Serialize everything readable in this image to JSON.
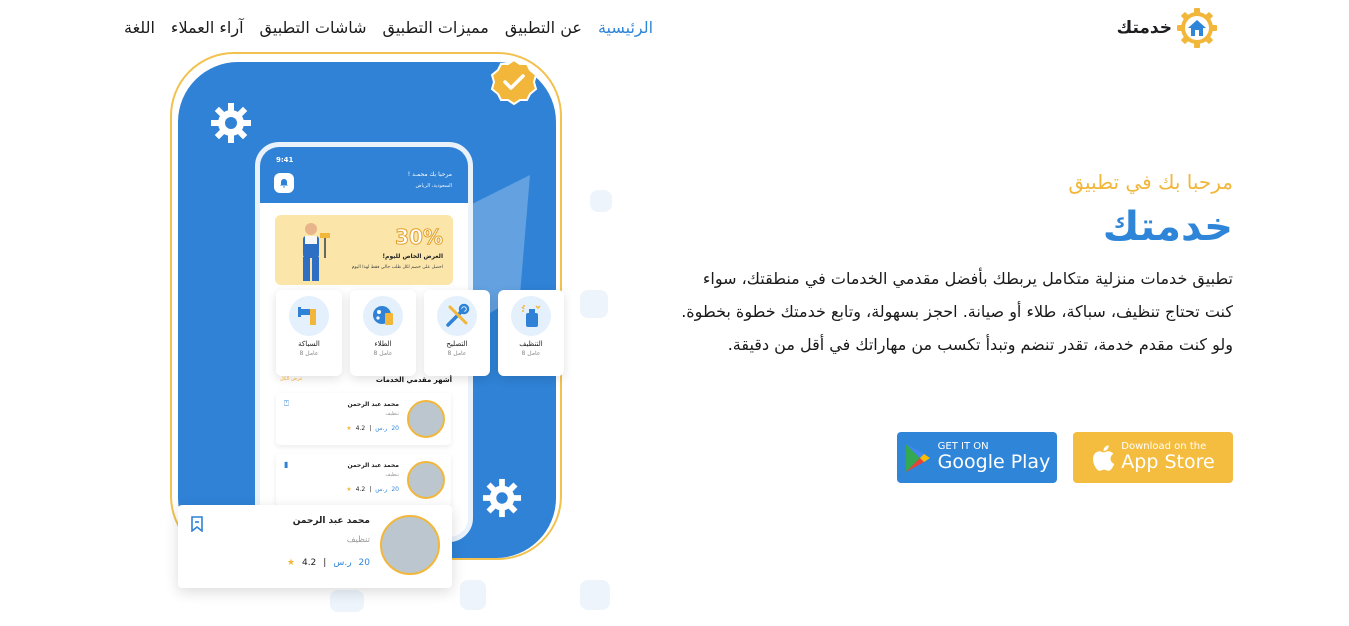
{
  "brand": {
    "name": "خدمتك",
    "logo_icon": "house-gear-icon"
  },
  "nav": {
    "items": [
      {
        "label": "الرئيسية",
        "active": true
      },
      {
        "label": "عن التطبيق",
        "active": false
      },
      {
        "label": "مميزات التطبيق",
        "active": false
      },
      {
        "label": "شاشات التطبيق",
        "active": false
      },
      {
        "label": "آراء العملاء",
        "active": false
      },
      {
        "label": "اللغة",
        "active": false
      }
    ]
  },
  "hero": {
    "welcome": "مرحبا بك في تطبيق",
    "title": "خدمتك",
    "description": "تطبيق خدمات منزلية متكامل يربطك بأفضل مقدمي الخدمات في منطقتك، سواء كنت تحتاج تنظيف، سباكة، طلاء أو صيانة. احجز بسهولة، وتابع خدمتك خطوة بخطوة. ولو كنت مقدم خدمة، تقدر تنضم وتبدأ تكسب من مهاراتك في أقل من دقيقة."
  },
  "stores": {
    "apple": {
      "small": "Download on the",
      "big": "App Store",
      "icon": "apple-icon"
    },
    "google": {
      "small": "GET IT ON",
      "big": "Google Play",
      "icon": "google-play-icon"
    }
  },
  "phone": {
    "time": "9:41",
    "greeting": "مرحبا بك محمـد !",
    "location": "السعودية، الرياض",
    "promo": {
      "percent": "30%",
      "title": "العرض الخاص لليوم!",
      "subtitle": "احصل على خصم لكل طلب جالي فقط لهذا اليوم"
    },
    "categories": [
      {
        "name": "التنظيف",
        "count": "8 عامل",
        "icon": "cleaning-spray-icon"
      },
      {
        "name": "التصليح",
        "count": "8 عامل",
        "icon": "wrench-screwdriver-icon"
      },
      {
        "name": "الطلاء",
        "count": "8 عامل",
        "icon": "paint-roller-icon"
      },
      {
        "name": "السباكة",
        "count": "8 عامل",
        "icon": "plumbing-pipe-icon"
      }
    ],
    "section_title": "أشهر مقدمي الخدمات",
    "section_more": "عرض الكل",
    "providers": [
      {
        "name": "محمد عبد الرحمن",
        "category": "تنظيف",
        "price": "20",
        "currency": "ر.س",
        "rating": "4.2"
      },
      {
        "name": "محمد عبد الرحمن",
        "category": "تنظيف",
        "price": "20",
        "currency": "ر.س",
        "rating": "4.2"
      }
    ]
  },
  "featured_provider": {
    "name": "محمد عبد الرحمن",
    "category": "تنظيف",
    "price": "20",
    "currency": "ر.س",
    "rating": "4.2"
  },
  "colors": {
    "primary": "#2f86d9",
    "accent": "#f2b73a"
  }
}
